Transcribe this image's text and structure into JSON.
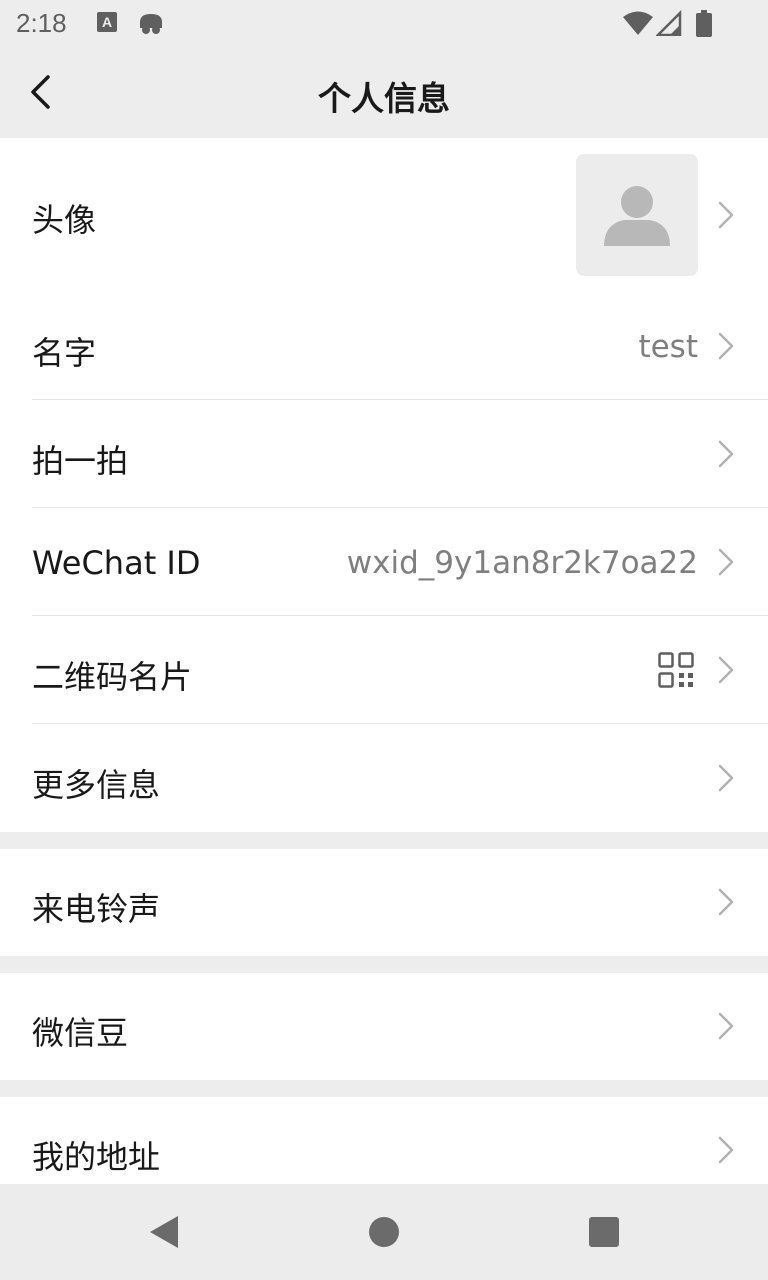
{
  "status_bar": {
    "time": "2:18",
    "icons": [
      "notification-a-icon",
      "android-icon",
      "wifi-icon",
      "signal-icon",
      "battery-icon"
    ]
  },
  "header": {
    "title": "个人信息",
    "back_icon": "back-arrow-icon"
  },
  "profile": {
    "avatar_label": "头像",
    "name_label": "名字",
    "name_value": "test",
    "pat_label": "拍一拍",
    "wechat_id_label": "WeChat ID",
    "wechat_id_value": "wxid_9y1an8r2k7oa22",
    "qr_label": "二维码名片",
    "more_label": "更多信息"
  },
  "ringtone": {
    "label": "来电铃声"
  },
  "beans": {
    "label": "微信豆"
  },
  "address": {
    "label": "我的地址"
  },
  "nav_bar": {
    "buttons": [
      "back-triangle-icon",
      "home-circle-icon",
      "recents-square-icon"
    ]
  },
  "colors": {
    "background": "#ededed",
    "card": "#ffffff",
    "text": "#191919",
    "secondary_text": "#7f7f7f",
    "chevron": "#b2b2b2",
    "divider": "#e5e5e5"
  }
}
